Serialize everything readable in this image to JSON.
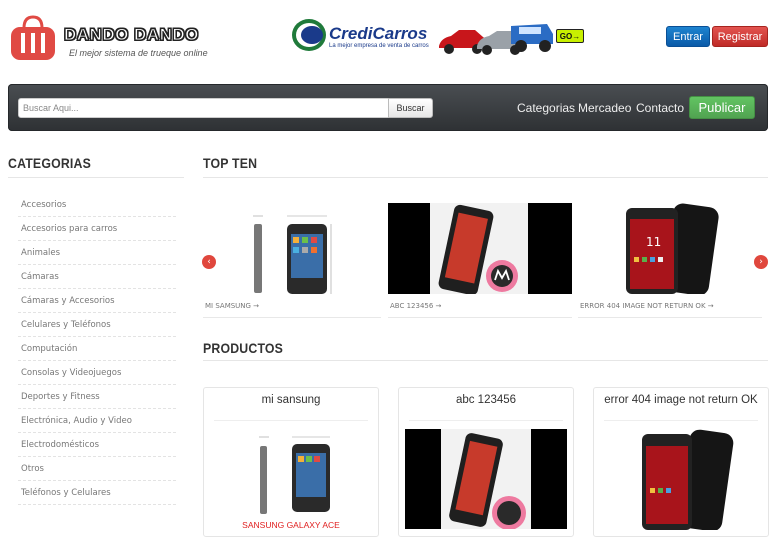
{
  "header": {
    "logo_text": "DANDO DANDO",
    "logo_tagline": "El mejor sistema de trueque online",
    "ad": {
      "brand_a": "Credi",
      "brand_b": "Carros",
      "tagline": "La mejor empresa de venta de carros",
      "go_label": "GO"
    },
    "login_label": "Entrar",
    "register_label": "Registrar"
  },
  "navbar": {
    "search_placeholder": "Buscar Aqui...",
    "search_button": "Buscar",
    "links": [
      "Categorias",
      "Mercadeo",
      "Contacto"
    ],
    "publish_label": "Publicar"
  },
  "sidebar": {
    "title": "CATEGORIAS",
    "items": [
      "Accesorios",
      "Accesorios para carros",
      "Animales",
      "Cámaras",
      "Cámaras y Accesorios",
      "Celulares y Teléfonos",
      "Computación",
      "Consolas y Videojuegos",
      "Deportes y Fitness",
      "Electrónica, Audio y Video",
      "Electrodomésticos",
      "Otros",
      "Teléfonos y Celulares"
    ]
  },
  "top_ten": {
    "title": "TOP TEN",
    "items": [
      {
        "caption": "MI SAMSUNG →"
      },
      {
        "caption": "ABC 123456 →"
      },
      {
        "caption": "ERROR 404 IMAGE NOT RETURN OK →"
      }
    ],
    "prev_icon": "chevron-left-icon",
    "next_icon": "chevron-right-icon"
  },
  "products": {
    "title": "PRODUCTOS",
    "items": [
      {
        "title": "mi sansung",
        "image_caption": "SANSUNG GALAXY ACE"
      },
      {
        "title": "abc 123456"
      },
      {
        "title": "error 404 image not return OK"
      }
    ]
  },
  "colors": {
    "navbar": "#3b3f42",
    "accent_red": "#e0473d",
    "green": "#5bb75b",
    "blue": "#0e6cc4"
  }
}
